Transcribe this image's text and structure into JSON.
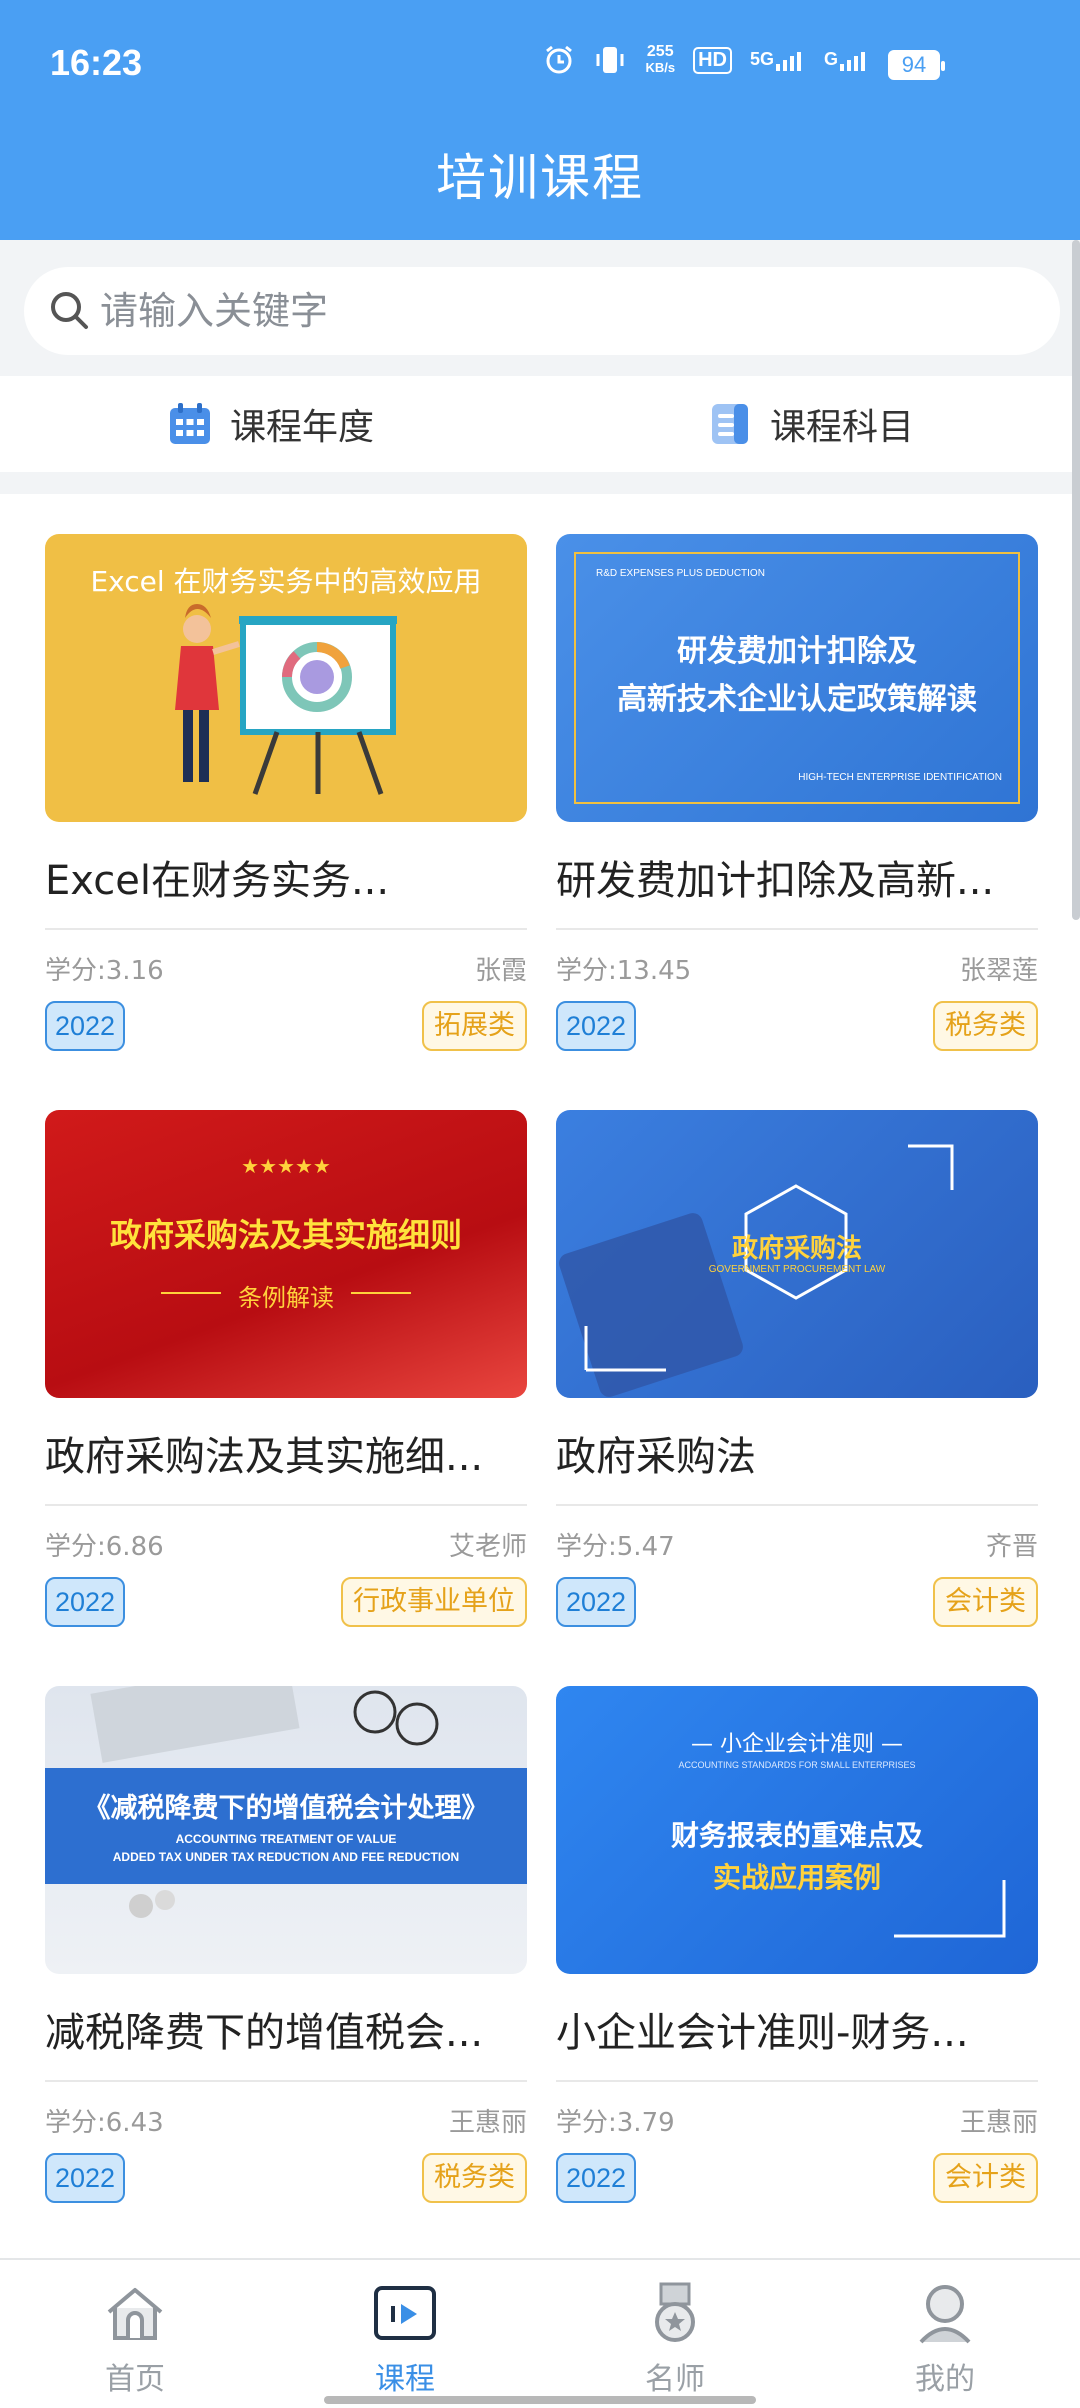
{
  "status_bar": {
    "time": "16:23",
    "speed_top": "255",
    "speed_bottom": "KB/s",
    "hd": "HD",
    "net1": "5G",
    "net2": "G",
    "battery": "94"
  },
  "header": {
    "title": "培训课程"
  },
  "search": {
    "placeholder": "请输入关键字"
  },
  "filters": [
    {
      "label": "课程年度",
      "icon": "calendar-icon"
    },
    {
      "label": "课程科目",
      "icon": "document-list-icon"
    }
  ],
  "courses": [
    {
      "title": "Excel在财务实务...",
      "credit": "学分:3.16",
      "teacher": "张霞",
      "year": "2022",
      "category": "拓展类",
      "thumb_text": [
        "Excel 在财务实务中的高效应用"
      ]
    },
    {
      "title": "研发费加计扣除及高新...",
      "credit": "学分:13.45",
      "teacher": "张翠莲",
      "year": "2022",
      "category": "税务类",
      "thumb_text": [
        "R&D EXPENSES PLUS DEDUCTION",
        "研发费加计扣除及",
        "高新技术企业认定政策解读",
        "HIGH-TECH ENTERPRISE IDENTIFICATION"
      ]
    },
    {
      "title": "政府采购法及其实施细...",
      "credit": "学分:6.86",
      "teacher": "艾老师",
      "year": "2022",
      "category": "行政事业单位",
      "thumb_text": [
        "★★★★★",
        "政府采购法及其实施细则",
        "条例解读"
      ]
    },
    {
      "title": "政府采购法",
      "credit": "学分:5.47",
      "teacher": "齐晋",
      "year": "2022",
      "category": "会计类",
      "thumb_text": [
        "政府采购法",
        "GOVERNMENT PROCUREMENT LAW"
      ]
    },
    {
      "title": "减税降费下的增值税会...",
      "credit": "学分:6.43",
      "teacher": "王惠丽",
      "year": "2022",
      "category": "税务类",
      "thumb_text": [
        "《减税降费下的增值税会计处理》",
        "ACCOUNTING TREATMENT OF VALUE",
        "ADDED TAX UNDER TAX REDUCTION AND FEE REDUCTION"
      ]
    },
    {
      "title": "小企业会计准则-财务...",
      "credit": "学分:3.79",
      "teacher": "王惠丽",
      "year": "2022",
      "category": "会计类",
      "thumb_text": [
        "— 小企业会计准则 —",
        "ACCOUNTING STANDARDS FOR SMALL ENTERPRISES",
        "财务报表的重难点及",
        "实战应用案例"
      ]
    }
  ],
  "bottom_nav": [
    {
      "label": "首页",
      "icon": "home-icon",
      "active": false
    },
    {
      "label": "课程",
      "icon": "play-video-icon",
      "active": true
    },
    {
      "label": "名师",
      "icon": "medal-icon",
      "active": false
    },
    {
      "label": "我的",
      "icon": "user-icon",
      "active": false
    }
  ],
  "colors": {
    "header_blue": "#4a9ff3",
    "active_blue": "#3a8fe6",
    "tag_blue": "#1f7fd6",
    "tag_orange": "#e5a21a"
  }
}
